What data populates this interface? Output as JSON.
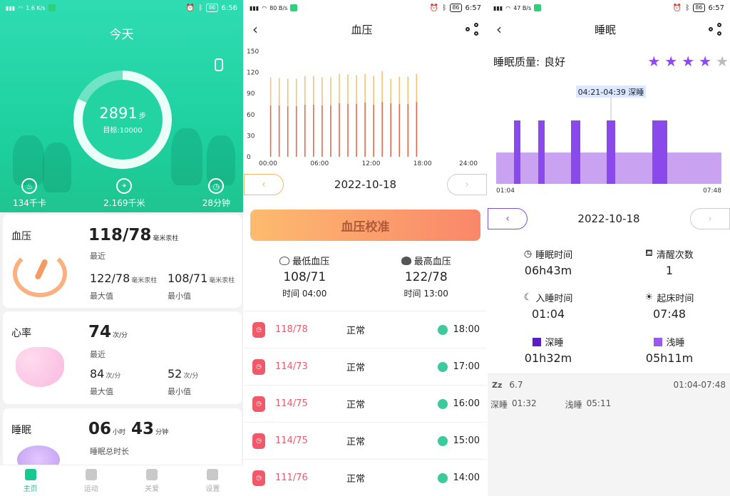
{
  "status": {
    "p1": {
      "net": "1.6 K/s",
      "time": "6:56",
      "battery": "86"
    },
    "p2": {
      "net": "80 B/s",
      "time": "6:57",
      "battery": "86"
    },
    "p3": {
      "net": "47 B/s",
      "time": "6:57",
      "battery": "86"
    }
  },
  "home": {
    "title": "今天",
    "steps": "2891",
    "steps_unit": "步",
    "goal": "目标:10000",
    "goal_progress": 0.82,
    "calories": "134千卡",
    "distance": "2.169千米",
    "duration": "28分钟",
    "bp_card": {
      "title": "血压",
      "value": "118/78",
      "unit": "毫米汞柱",
      "recent": "最近",
      "max_value": "122/78",
      "max_unit": "毫米汞柱",
      "max_label": "最大值",
      "min_value": "108/71",
      "min_unit": "毫米汞柱",
      "min_label": "最小值"
    },
    "hr_card": {
      "title": "心率",
      "value": "74",
      "unit": "次/分",
      "recent": "最近",
      "max_value": "84",
      "max_unit": "次/分",
      "max_label": "最大值",
      "min_value": "52",
      "min_unit": "次/分",
      "min_label": "最小值"
    },
    "sleep_card": {
      "title": "睡眠",
      "hours": "06",
      "hours_unit": "小时",
      "minutes": "43",
      "minutes_unit": "分钟",
      "label": "睡眠总时长"
    },
    "tabs": [
      {
        "label": "主页",
        "icon": "home-icon"
      },
      {
        "label": "运动",
        "icon": "run-icon"
      },
      {
        "label": "关爱",
        "icon": "heart-icon"
      },
      {
        "label": "设置",
        "icon": "gear-icon"
      }
    ]
  },
  "bp": {
    "title": "血压",
    "date": "2022-10-18",
    "calibrate": "血压校准",
    "lowest_label": "最低血压",
    "lowest_value": "108/71",
    "lowest_time": "时间 04:00",
    "highest_label": "最高血压",
    "highest_value": "122/78",
    "highest_time": "时间 13:00",
    "records": [
      {
        "value": "118/78",
        "status": "正常",
        "time": "18:00"
      },
      {
        "value": "114/73",
        "status": "正常",
        "time": "17:00"
      },
      {
        "value": "114/75",
        "status": "正常",
        "time": "16:00"
      },
      {
        "value": "114/75",
        "status": "正常",
        "time": "15:00"
      },
      {
        "value": "111/76",
        "status": "正常",
        "time": "14:00"
      }
    ]
  },
  "chart_data": {
    "type": "bar",
    "yticks": [
      "150",
      "120",
      "90",
      "60",
      "30",
      "0"
    ],
    "xticks": [
      "00:00",
      "06:00",
      "12:00",
      "18:00",
      "24:00"
    ],
    "ylim": [
      0,
      150
    ],
    "xlim": [
      0,
      24
    ],
    "series": [
      {
        "x": [
          0.3,
          1.3,
          2.3,
          3.3,
          4.3,
          5.3,
          6.3,
          7.3,
          8.3,
          9.3,
          10.3,
          11.3,
          12.3,
          13.3,
          14.3,
          15.3,
          16.3,
          17.3
        ],
        "systolic": [
          113,
          112,
          111,
          111,
          115,
          115,
          113,
          113,
          118,
          117,
          116,
          118,
          115,
          122,
          111,
          114,
          114,
          118
        ],
        "diastolic": [
          73,
          73,
          72,
          72,
          74,
          74,
          73,
          73,
          76,
          75,
          75,
          77,
          74,
          78,
          76,
          75,
          75,
          78
        ]
      }
    ]
  },
  "sleep": {
    "title": "睡眠",
    "quality_label": "睡眠质量:",
    "quality_value": "良好",
    "stars": 4,
    "stars_total": 5,
    "tooltip": "04:21-04:39 深睡",
    "start": "01:04",
    "end": "07:48",
    "date": "2022-10-18",
    "sleep_time_label": "睡眠时间",
    "sleep_time": "06h43m",
    "wake_label": "清醒次数",
    "wake_count": "1",
    "bedtime_label": "入睡时间",
    "bedtime": "01:04",
    "rise_label": "起床时间",
    "rise": "07:48",
    "deep_label": "深睡",
    "deep": "01h32m",
    "light_label": "浅睡",
    "light": "05h11m",
    "zz": "Zz",
    "score": "6.7",
    "range": "01:04-07:48",
    "foot_deep_label": "深睡",
    "foot_deep": "01:32",
    "foot_light_label": "浅睡",
    "foot_light": "05:11",
    "colors": {
      "deep": "#6a2fd8",
      "light": "#c9a3f2",
      "deep_bar": "#8a49ea"
    }
  }
}
